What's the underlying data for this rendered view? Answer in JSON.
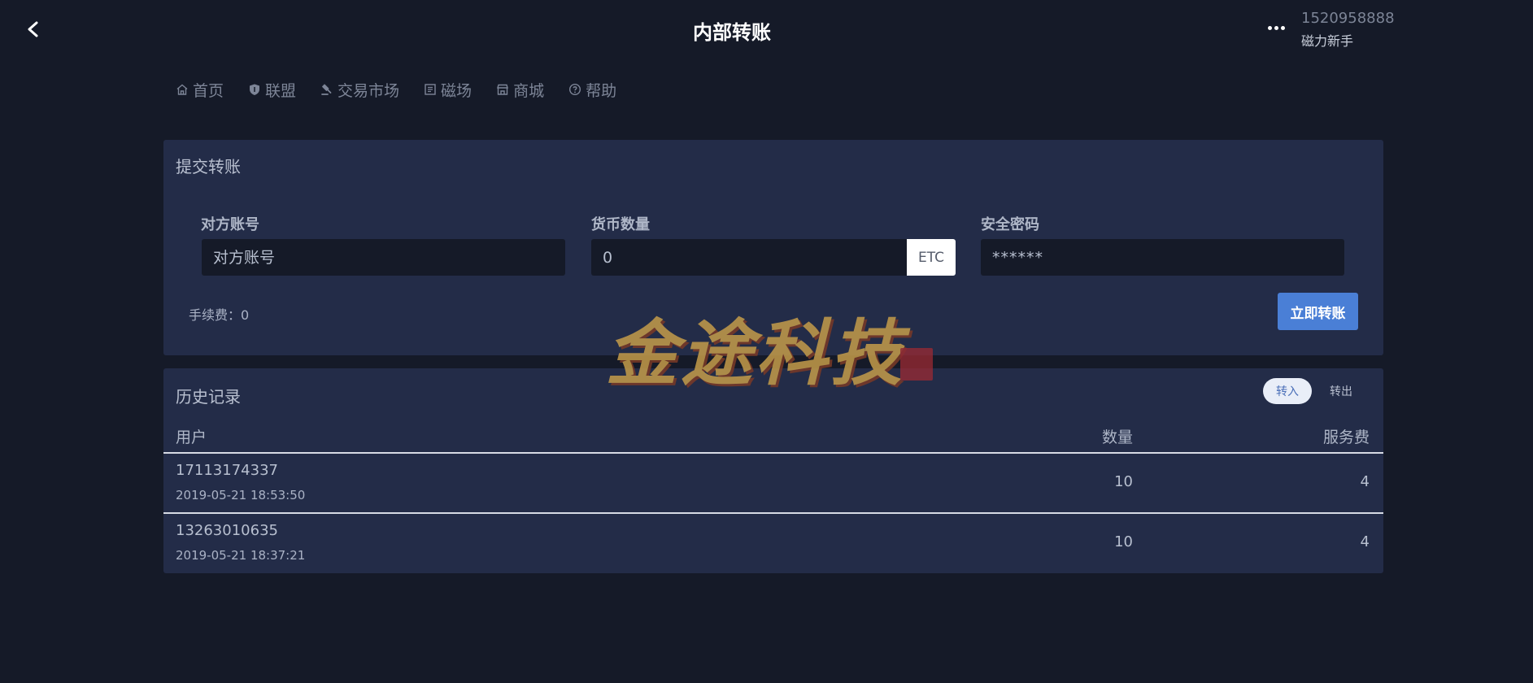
{
  "header": {
    "title": "内部转账",
    "back_label": "<",
    "more_icon": "ellipsis-icon",
    "user_phone": "1520958888",
    "user_level": "磁力新手"
  },
  "nav": {
    "items": [
      {
        "label": "首页",
        "icon": "home-icon"
      },
      {
        "label": "联盟",
        "icon": "shield-icon"
      },
      {
        "label": "交易市场",
        "icon": "auction-icon"
      },
      {
        "label": "磁场",
        "icon": "field-icon"
      },
      {
        "label": "商城",
        "icon": "store-icon"
      },
      {
        "label": "帮助",
        "icon": "help-icon"
      }
    ]
  },
  "submit": {
    "title": "提交转账",
    "account_label": "对方账号",
    "account_placeholder": "对方账号",
    "amount_label": "货币数量",
    "amount_value": "0",
    "currency": "ETC",
    "password_label": "安全密码",
    "password_placeholder": "******",
    "fee_text": "手续费：0",
    "submit_label": "立即转账"
  },
  "history": {
    "title": "历史记录",
    "tabs": [
      {
        "label": "转入",
        "active": true
      },
      {
        "label": "转出",
        "active": false
      }
    ],
    "columns": [
      "用户",
      "数量",
      "服务费"
    ],
    "rows": [
      {
        "user": "17113174337",
        "time": "2019-05-21 18:53:50",
        "qty": "10",
        "fee": "4"
      },
      {
        "user": "13263010635",
        "time": "2019-05-21 18:37:21",
        "qty": "10",
        "fee": "4"
      }
    ]
  },
  "watermark": {
    "text": "金途科技"
  },
  "colors": {
    "background": "#151a28",
    "card": "#232c48",
    "accent": "#4a7fd6",
    "text": "#aab2c5"
  }
}
